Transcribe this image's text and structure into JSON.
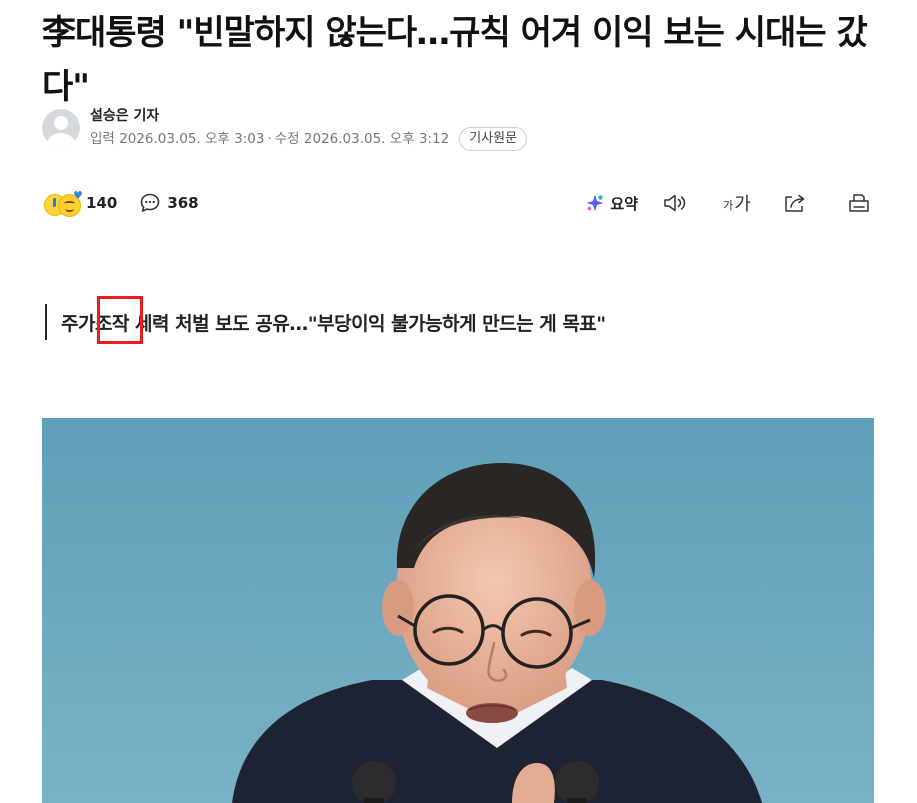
{
  "article": {
    "headline": "李대통령 \"빈말하지 않는다…규칙 어겨 이익 보는 시대는 갔다\"",
    "reporter": "설승은 기자",
    "published": "입력 2026.03.05. 오후 3:03",
    "separator": "·",
    "modified": "수정 2026.03.05. 오후 3:12",
    "original_link_label": "기사원문",
    "subheadline": "주가조작 세력 처벌 보도 공유…\"부당이익 불가능하게 만드는 게 목표\""
  },
  "toolbar": {
    "reaction_count": "140",
    "comment_count": "368",
    "summary_label": "요약",
    "font_small_glyph": "가",
    "font_large_glyph": "가"
  },
  "icons": {
    "avatar": "default-user-avatar",
    "reactions": "reaction-emoji-cluster",
    "comment": "speech-bubble-icon",
    "summary": "ai-sparkle-icon",
    "speaker": "speaker-icon",
    "font_size": "font-size-icon",
    "share": "share-icon",
    "print": "print-icon"
  },
  "colors": {
    "highlight_box": "#e61e1e",
    "summary_sparkle_primary": "#5b5bf5",
    "summary_sparkle_secondary": "#2bb3e6",
    "photo_background": "#6aa6bd"
  },
  "photo": {
    "description_alt": ""
  }
}
